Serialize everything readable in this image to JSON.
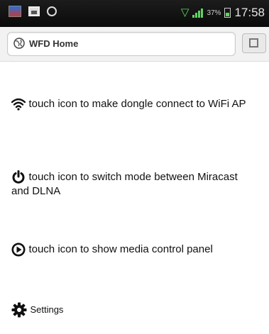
{
  "status_bar": {
    "battery_percent": "37%",
    "time": "17:58",
    "icons": [
      "app-icon",
      "image-icon",
      "phone-icon",
      "wifi-icon",
      "signal-icon",
      "battery-icon"
    ]
  },
  "browser": {
    "page_title": "WFD Home",
    "icons": [
      "globe-icon",
      "tabs-icon"
    ]
  },
  "items": [
    {
      "icon": "wifi-icon",
      "text": "touch icon to make dongle connect to WiFi AP"
    },
    {
      "icon": "power-icon",
      "text": "touch icon to switch mode between Miracast and DLNA"
    },
    {
      "icon": "play-icon",
      "text": "touch icon to show media control panel"
    },
    {
      "icon": "gear-icon",
      "text": "Settings"
    }
  ]
}
